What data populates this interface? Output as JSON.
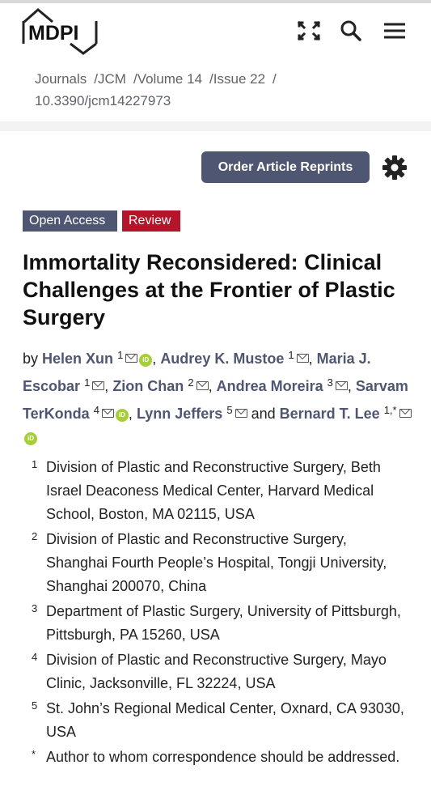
{
  "header": {
    "logo_text": "MDPI",
    "icons": [
      "fullscreen-icon",
      "search-icon",
      "menu-icon"
    ]
  },
  "breadcrumb": {
    "items": [
      "Journals",
      "JCM",
      "Volume 14",
      "Issue 22"
    ],
    "separator": "/",
    "doi": "10.3390/jcm14227973"
  },
  "toolbar": {
    "order_label": "Order Article Reprints"
  },
  "badges": {
    "open_access": "Open Access",
    "type": "Review"
  },
  "article": {
    "title": "Immortality Reconsidered: Clinical Challenges at the Frontier of Plastic Surgery",
    "by": "by",
    "and": "and",
    "authors": [
      {
        "name": "Helen Xun",
        "sup": "1"
      },
      {
        "name": "Audrey K. Mustoe",
        "sup": "1"
      },
      {
        "name": "Maria J. Escobar",
        "sup": "1"
      },
      {
        "name": "Zion Chan",
        "sup": "2"
      },
      {
        "name": "Andrea Moreira",
        "sup": "3"
      },
      {
        "name": "Sarvam TerKonda",
        "sup": "4"
      },
      {
        "name": "Lynn Jeffers",
        "sup": "5"
      },
      {
        "name": "Bernard T. Lee",
        "sup": "1,*"
      }
    ]
  },
  "affiliations": [
    {
      "num": "1",
      "text": "Division of Plastic and Reconstructive Surgery, Beth Israel Deaconess Medical Center, Harvard Medical School, Boston, MA 02115, USA"
    },
    {
      "num": "2",
      "text": "Division of Plastic and Reconstructive Surgery, Shanghai Fourth People’s Hospital, Tongji University, Shanghai 200070, China"
    },
    {
      "num": "3",
      "text": "Department of Plastic Surgery, University of Pittsburgh, Pittsburgh, PA 15260, USA"
    },
    {
      "num": "4",
      "text": "Division of Plastic and Reconstructive Surgery, Mayo Clinic, Jacksonville, FL 32224, USA"
    },
    {
      "num": "5",
      "text": "St. John’s Regional Medical Center, Oxnard, CA 93030, USA"
    },
    {
      "num": "*",
      "text": "Author to whom correspondence should be addressed."
    }
  ],
  "colors": {
    "accent": "#4f5671",
    "review": "#b5152b",
    "orcid": "#a6ce39"
  }
}
